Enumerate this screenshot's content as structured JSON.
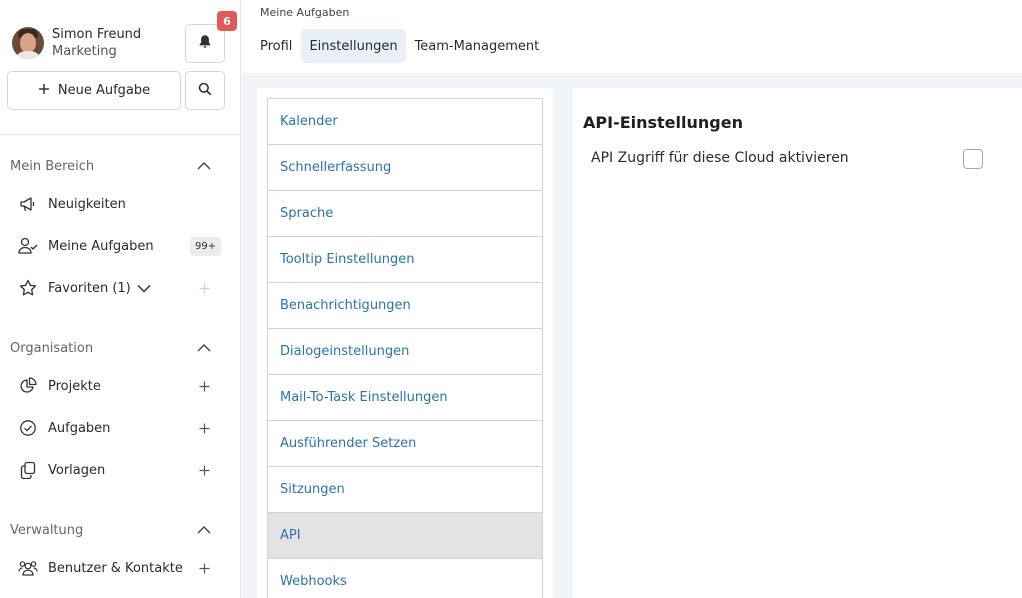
{
  "user": {
    "name": "Simon Freund",
    "department": "Marketing"
  },
  "notifications": {
    "count": "6"
  },
  "actions": {
    "new_task_label": "Neue Aufgabe"
  },
  "sidebar": {
    "sections": [
      {
        "title": "Mein Bereich",
        "items": [
          {
            "label": "Neuigkeiten",
            "icon": "megaphone-icon"
          },
          {
            "label": "Meine Aufgaben",
            "icon": "user-check-icon",
            "badge": "99+"
          },
          {
            "label": "Favoriten (1)",
            "icon": "star-icon"
          }
        ]
      },
      {
        "title": "Organisation",
        "items": [
          {
            "label": "Projekte",
            "icon": "pie-chart-icon"
          },
          {
            "label": "Aufgaben",
            "icon": "check-circle-icon"
          },
          {
            "label": "Vorlagen",
            "icon": "copy-icon"
          }
        ]
      },
      {
        "title": "Verwaltung",
        "items": [
          {
            "label": "Benutzer & Kontakte",
            "icon": "users-icon"
          }
        ]
      }
    ]
  },
  "header": {
    "breadcrumb": "Meine Aufgaben",
    "tabs": [
      {
        "label": "Profil",
        "active": false
      },
      {
        "label": "Einstellungen",
        "active": true
      },
      {
        "label": "Team-Management",
        "active": false
      }
    ]
  },
  "settings_menu": {
    "items": [
      "Kalender",
      "Schnellerfassung",
      "Sprache",
      "Tooltip Einstellungen",
      "Benachrichtigungen",
      "Dialogeinstellungen",
      "Mail-To-Task Einstellungen",
      "Ausführender Setzen",
      "Sitzungen",
      "API",
      "Webhooks"
    ],
    "selected": "API"
  },
  "api_settings": {
    "title": "API-Einstellungen",
    "toggle_label": "API Zugriff für diese Cloud aktivieren",
    "checked": false
  },
  "colors": {
    "accent_link": "#2a74a8",
    "badge_red": "#e05a5a",
    "active_tab_bg": "#e9f0f7",
    "content_bg": "#f1f5f9",
    "selected_item_bg": "#e3e3e3"
  }
}
